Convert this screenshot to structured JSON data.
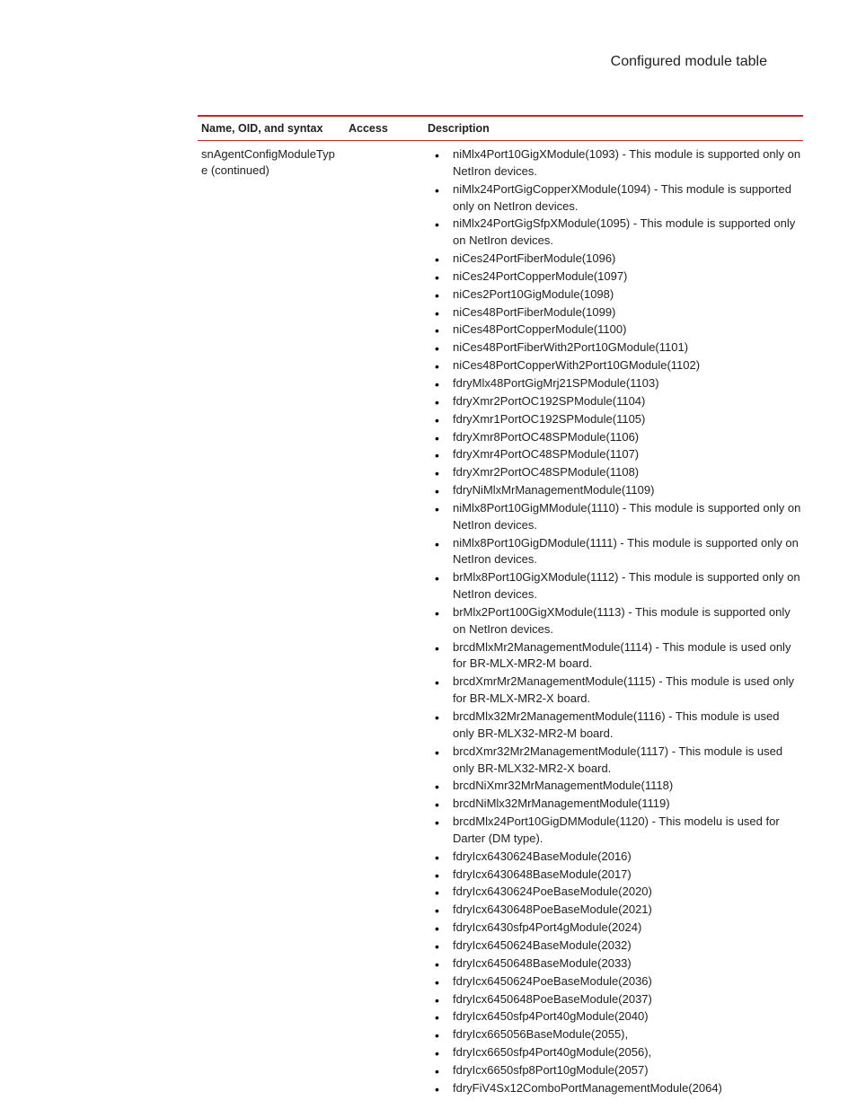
{
  "page_header": "Configured module table",
  "table": {
    "headers": {
      "name": "Name, OID, and syntax",
      "access": "Access",
      "description": "Description"
    },
    "row": {
      "name": "snAgentConfigModuleType (continued)",
      "access": "",
      "items": [
        "niMlx4Port10GigXModule(1093) - This module is supported only on NetIron devices.",
        "niMlx24PortGigCopperXModule(1094) - This module is supported only on NetIron devices.",
        "niMlx24PortGigSfpXModule(1095) - This module is supported only on NetIron devices.",
        "niCes24PortFiberModule(1096)",
        "niCes24PortCopperModule(1097)",
        "niCes2Port10GigModule(1098)",
        "niCes48PortFiberModule(1099)",
        "niCes48PortCopperModule(1100)",
        "niCes48PortFiberWith2Port10GModule(1101)",
        "niCes48PortCopperWith2Port10GModule(1102)",
        "fdryMlx48PortGigMrj21SPModule(1103)",
        "fdryXmr2PortOC192SPModule(1104)",
        "fdryXmr1PortOC192SPModule(1105)",
        "fdryXmr8PortOC48SPModule(1106)",
        "fdryXmr4PortOC48SPModule(1107)",
        "fdryXmr2PortOC48SPModule(1108)",
        "fdryNiMlxMrManagementModule(1109)",
        "niMlx8Port10GigMModule(1110) - This module is supported only on NetIron devices.",
        "niMlx8Port10GigDModule(1111) - This module is supported only on NetIron devices.",
        "brMlx8Port10GigXModule(1112) - This module is supported only on NetIron devices.",
        "brMlx2Port100GigXModule(1113) - This module is supported only on NetIron devices.",
        "brcdMlxMr2ManagementModule(1114) - This module is used only for BR-MLX-MR2-M board.",
        "brcdXmrMr2ManagementModule(1115) - This module is used only for BR-MLX-MR2-X board.",
        "brcdMlx32Mr2ManagementModule(1116) - This module is used only BR-MLX32-MR2-M board.",
        "brcdXmr32Mr2ManagementModule(1117) - This module is used only BR-MLX32-MR2-X board.",
        "brcdNiXmr32MrManagementModule(1118)",
        "brcdNiMlx32MrManagementModule(1119)",
        "brcdMlx24Port10GigDMModule(1120) - This modelu is used for Darter (DM type).",
        "fdryIcx6430624BaseModule(2016)",
        "fdryIcx6430648BaseModule(2017)",
        "fdryIcx6430624PoeBaseModule(2020)",
        "fdryIcx6430648PoeBaseModule(2021)",
        "fdryIcx6430sfp4Port4gModule(2024)",
        "fdryIcx6450624BaseModule(2032)",
        "fdryIcx6450648BaseModule(2033)",
        "fdryIcx6450624PoeBaseModule(2036)",
        "fdryIcx6450648PoeBaseModule(2037)",
        "fdryIcx6450sfp4Port40gModule(2040)",
        "fdryIcx665056BaseModule(2055),",
        "fdryIcx6650sfp4Port40gModule(2056),",
        "fdryIcx6650sfp8Port10gModule(2057)",
        "fdryFiV4Sx12ComboPortManagementModule(2064)"
      ]
    }
  }
}
